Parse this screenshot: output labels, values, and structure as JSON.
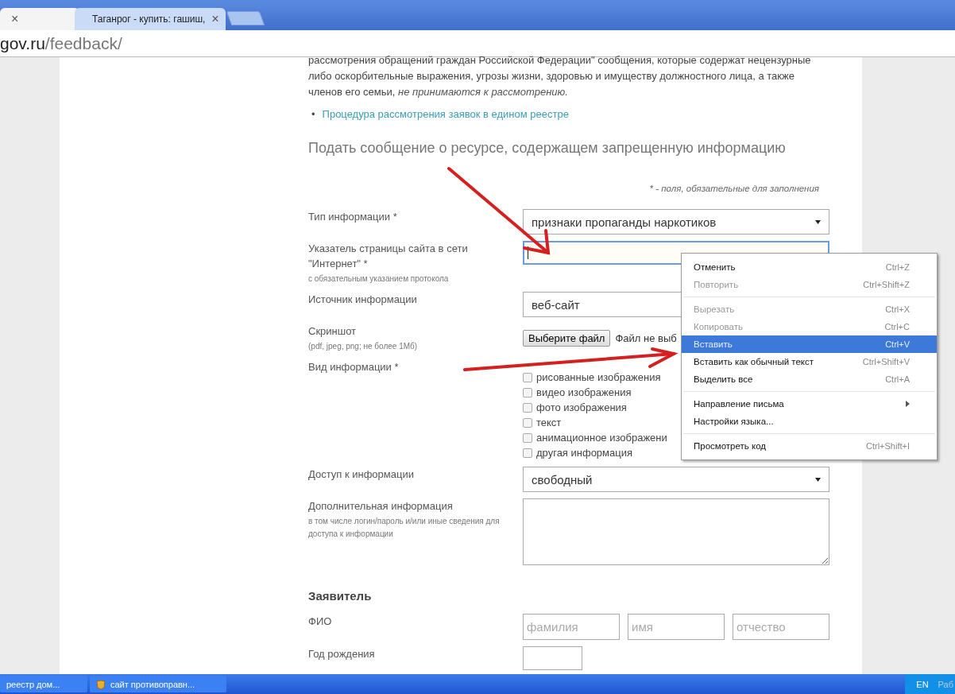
{
  "browser": {
    "tabs": [
      {
        "close": "×",
        "selected": true
      },
      {
        "title": "Таганрог - купить: гашиш,",
        "close": "×",
        "selected": false
      }
    ],
    "address": {
      "host": "gov.ru",
      "path": "/feedback/"
    }
  },
  "intro": {
    "text": "рассмотрения обращений граждан Российской Федерации\" сообщения, которые содержат нецензурные либо оскорбительные выражения, угрозы жизни, здоровью и имуществу должностного лица, а также членов его семьи, *не принимаются к рассмотрению.*",
    "links": [
      {
        "bullet": "•",
        "text": "Процедура рассмотрения заявок в едином реестре"
      }
    ]
  },
  "form": {
    "title": "Подать сообщение о ресурсе, содержащем запрещенную информацию",
    "required_note": "* - поля, обязательные для заполнения",
    "fields": [
      {
        "kind": "select",
        "label": "Тип информации *",
        "value": "признаки пропаганды наркотиков",
        "caret": true
      },
      {
        "kind": "text",
        "label": "Указатель страницы сайта в сети \"Интернет\" *",
        "hint": "с обязательным указанием протокола",
        "focused": true
      },
      {
        "kind": "select",
        "label": "Источник информации",
        "value": "веб-сайт"
      },
      {
        "kind": "file",
        "label": "Скриншот",
        "hint": "(pdf, jpeg, png; не более 1Мб)",
        "button": "Выберите файл",
        "status": "Файл не выб"
      },
      {
        "kind": "checkboxes",
        "label": "Вид информации *",
        "options": [
          {
            "label": "рисованные изображения",
            "checked": false
          },
          {
            "label": "видео изображения",
            "checked": false
          },
          {
            "label": "фото изображения",
            "checked": false
          },
          {
            "label": "текст",
            "checked": false
          },
          {
            "label": "анимационное изображени",
            "checked": false
          },
          {
            "label": "другая информация",
            "checked": false
          }
        ]
      },
      {
        "kind": "select",
        "label": "Доступ к информации",
        "value": "свободный",
        "caret": true
      },
      {
        "kind": "textarea",
        "label": "Дополнительная информация",
        "hint": "в том числе логин/пароль и/или иные сведения для доступа к информации"
      }
    ],
    "applicant": {
      "title": "Заявитель",
      "fields": [
        {
          "kind": "name",
          "label": "ФИО",
          "placeholders": [
            "фамилия",
            "имя",
            "отчество"
          ]
        },
        {
          "kind": "year",
          "label": "Год рождения"
        }
      ]
    }
  },
  "context_menu": {
    "groups": [
      [
        {
          "label": "Отменить",
          "shortcut": "Ctrl+Z",
          "disabled": false,
          "selected": false
        },
        {
          "label": "Повторить",
          "shortcut": "Ctrl+Shift+Z",
          "disabled": true,
          "selected": false
        }
      ],
      [
        {
          "label": "Вырезать",
          "shortcut": "Ctrl+X",
          "disabled": true,
          "selected": false
        },
        {
          "label": "Копировать",
          "shortcut": "Ctrl+C",
          "disabled": true,
          "selected": false
        },
        {
          "label": "Вставить",
          "shortcut": "Ctrl+V",
          "disabled": false,
          "selected": true
        },
        {
          "label": "Вставить как обычный текст",
          "shortcut": "Ctrl+Shift+V",
          "disabled": false,
          "selected": false
        },
        {
          "label": "Выделить все",
          "shortcut": "Ctrl+A",
          "disabled": false,
          "selected": false
        }
      ],
      [
        {
          "label": "Направление письма",
          "submenu": true,
          "disabled": false,
          "selected": false
        },
        {
          "label": "Настройки языка...",
          "disabled": false,
          "selected": false
        }
      ],
      [
        {
          "label": "Просмотреть код",
          "shortcut": "Ctrl+Shift+I",
          "disabled": false,
          "selected": false
        }
      ]
    ]
  },
  "taskbar": {
    "items": [
      {
        "label": "реестр дом...",
        "icon": false
      },
      {
        "label": "сайт противоправн...",
        "icon": true
      }
    ],
    "tray": {
      "language": "EN",
      "text": "Раб"
    }
  }
}
